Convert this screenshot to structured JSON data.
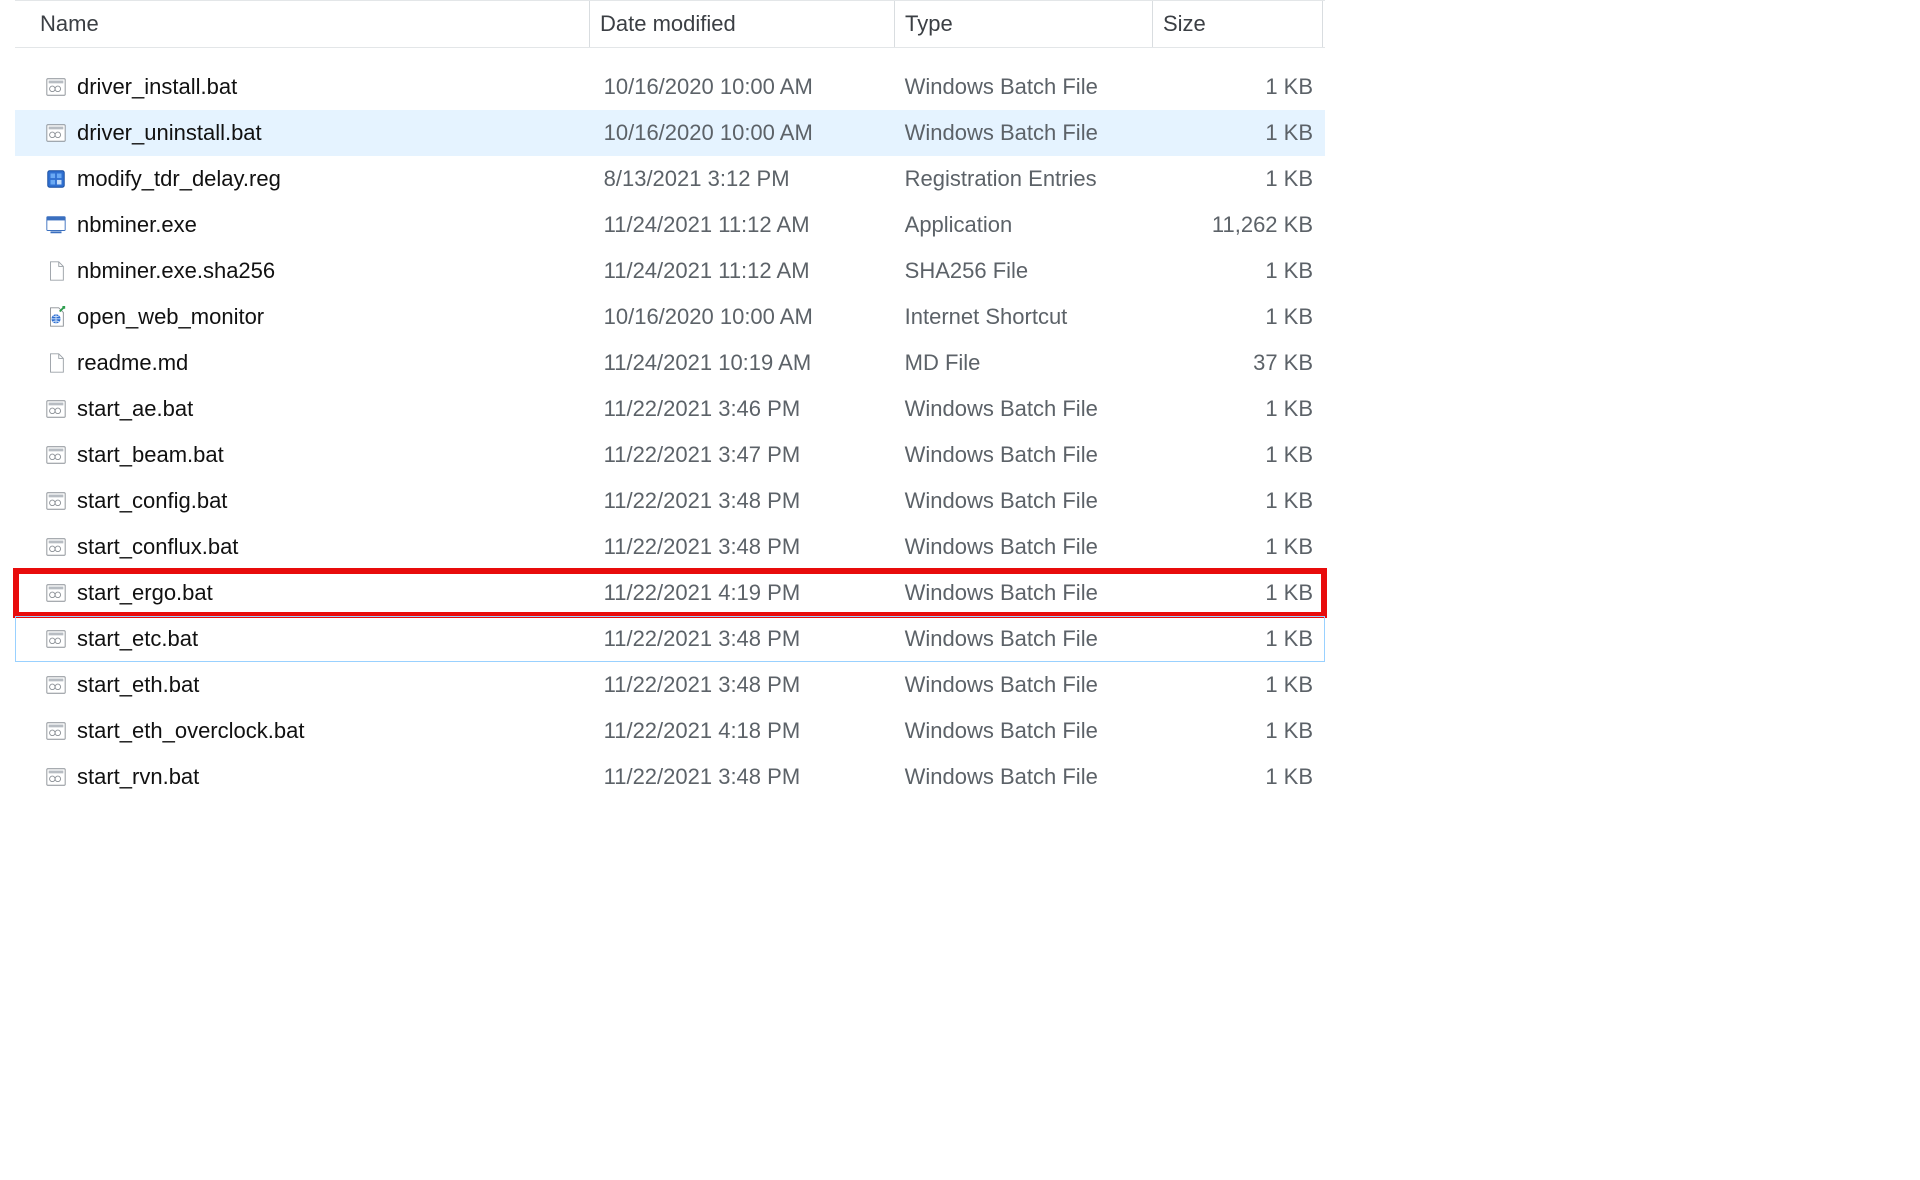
{
  "columns": {
    "name": "Name",
    "date": "Date modified",
    "type": "Type",
    "size": "Size"
  },
  "sorted_column": "name",
  "files": [
    {
      "icon": "bat",
      "name": "driver_install.bat",
      "date": "10/16/2020 10:00 AM",
      "type": "Windows Batch File",
      "size": "1 KB",
      "selected": false,
      "outlined": false,
      "highlighted": false
    },
    {
      "icon": "bat",
      "name": "driver_uninstall.bat",
      "date": "10/16/2020 10:00 AM",
      "type": "Windows Batch File",
      "size": "1 KB",
      "selected": true,
      "outlined": false,
      "highlighted": false
    },
    {
      "icon": "reg",
      "name": "modify_tdr_delay.reg",
      "date": "8/13/2021 3:12 PM",
      "type": "Registration Entries",
      "size": "1 KB",
      "selected": false,
      "outlined": false,
      "highlighted": false
    },
    {
      "icon": "exe",
      "name": "nbminer.exe",
      "date": "11/24/2021 11:12 AM",
      "type": "Application",
      "size": "11,262 KB",
      "selected": false,
      "outlined": false,
      "highlighted": false
    },
    {
      "icon": "file",
      "name": "nbminer.exe.sha256",
      "date": "11/24/2021 11:12 AM",
      "type": "SHA256 File",
      "size": "1 KB",
      "selected": false,
      "outlined": false,
      "highlighted": false
    },
    {
      "icon": "url",
      "name": "open_web_monitor",
      "date": "10/16/2020 10:00 AM",
      "type": "Internet Shortcut",
      "size": "1 KB",
      "selected": false,
      "outlined": false,
      "highlighted": false
    },
    {
      "icon": "file",
      "name": "readme.md",
      "date": "11/24/2021 10:19 AM",
      "type": "MD File",
      "size": "37 KB",
      "selected": false,
      "outlined": false,
      "highlighted": false
    },
    {
      "icon": "bat",
      "name": "start_ae.bat",
      "date": "11/22/2021 3:46 PM",
      "type": "Windows Batch File",
      "size": "1 KB",
      "selected": false,
      "outlined": false,
      "highlighted": false
    },
    {
      "icon": "bat",
      "name": "start_beam.bat",
      "date": "11/22/2021 3:47 PM",
      "type": "Windows Batch File",
      "size": "1 KB",
      "selected": false,
      "outlined": false,
      "highlighted": false
    },
    {
      "icon": "bat",
      "name": "start_config.bat",
      "date": "11/22/2021 3:48 PM",
      "type": "Windows Batch File",
      "size": "1 KB",
      "selected": false,
      "outlined": false,
      "highlighted": false
    },
    {
      "icon": "bat",
      "name": "start_conflux.bat",
      "date": "11/22/2021 3:48 PM",
      "type": "Windows Batch File",
      "size": "1 KB",
      "selected": false,
      "outlined": false,
      "highlighted": false
    },
    {
      "icon": "bat",
      "name": "start_ergo.bat",
      "date": "11/22/2021 4:19 PM",
      "type": "Windows Batch File",
      "size": "1 KB",
      "selected": false,
      "outlined": false,
      "highlighted": true
    },
    {
      "icon": "bat",
      "name": "start_etc.bat",
      "date": "11/22/2021 3:48 PM",
      "type": "Windows Batch File",
      "size": "1 KB",
      "selected": false,
      "outlined": true,
      "highlighted": false
    },
    {
      "icon": "bat",
      "name": "start_eth.bat",
      "date": "11/22/2021 3:48 PM",
      "type": "Windows Batch File",
      "size": "1 KB",
      "selected": false,
      "outlined": false,
      "highlighted": false
    },
    {
      "icon": "bat",
      "name": "start_eth_overclock.bat",
      "date": "11/22/2021 4:18 PM",
      "type": "Windows Batch File",
      "size": "1 KB",
      "selected": false,
      "outlined": false,
      "highlighted": false
    },
    {
      "icon": "bat",
      "name": "start_rvn.bat",
      "date": "11/22/2021 3:48 PM",
      "type": "Windows Batch File",
      "size": "1 KB",
      "selected": false,
      "outlined": false,
      "highlighted": false
    }
  ]
}
